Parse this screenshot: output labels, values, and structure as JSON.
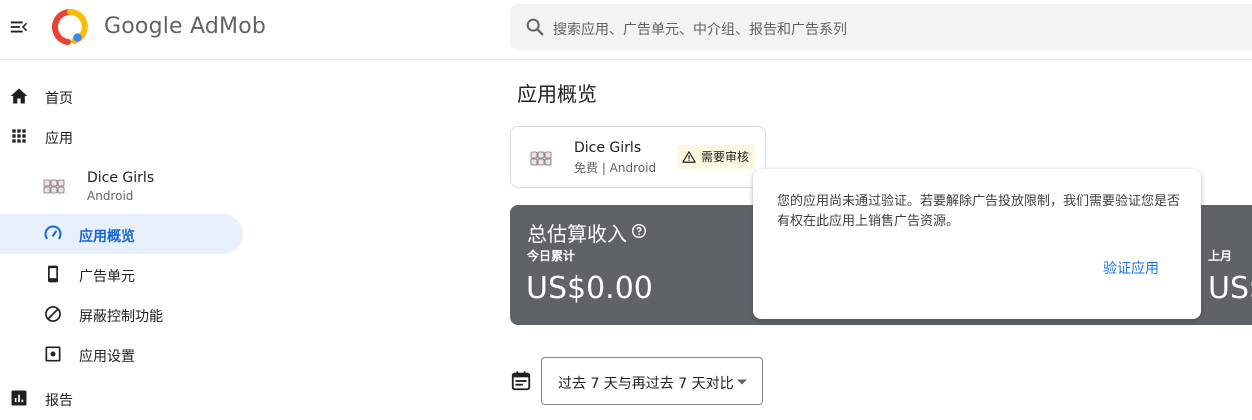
{
  "header": {
    "brand_google": "Google",
    "brand_product": "AdMob",
    "search_placeholder": "搜索应用、广告单元、中介组、报告和广告系列"
  },
  "sidebar": {
    "home": "首页",
    "apps": "应用",
    "app": {
      "name": "Dice Girls",
      "platform": "Android"
    },
    "overview": "应用概览",
    "ad_units": "广告单元",
    "blocking": "屏蔽控制功能",
    "app_settings": "应用设置",
    "reports": "报告"
  },
  "main": {
    "title": "应用概览",
    "app_card": {
      "name": "Dice Girls",
      "sub": "免费 | Android",
      "badge": "需要审核"
    },
    "earnings": {
      "title": "总估算收入",
      "today_label": "今日累计",
      "today_value": "US$0.00",
      "last_month_label": "上月",
      "last_month_value": "US$"
    },
    "popup": {
      "text": "您的应用尚未通过验证。若要解除广告投放限制，我们需要验证您是否有权在此应用上销售广告资源。",
      "button": "验证应用"
    },
    "date_range": "过去 7 天与再过去 7 天对比"
  },
  "colors": {
    "accent": "#1a73e8",
    "active_bg": "#e8f0fe",
    "earnings_bg": "#5f6368",
    "badge_bg": "#fef7e0"
  },
  "icons": [
    "menu-collapse-icon",
    "admob-logo",
    "search-icon",
    "home-icon",
    "apps-grid-icon",
    "dice-app-icon",
    "gauge-icon",
    "phone-icon",
    "block-icon",
    "settings-icon",
    "report-icon",
    "warning-icon",
    "help-icon",
    "calendar-icon",
    "caret-down-icon"
  ]
}
